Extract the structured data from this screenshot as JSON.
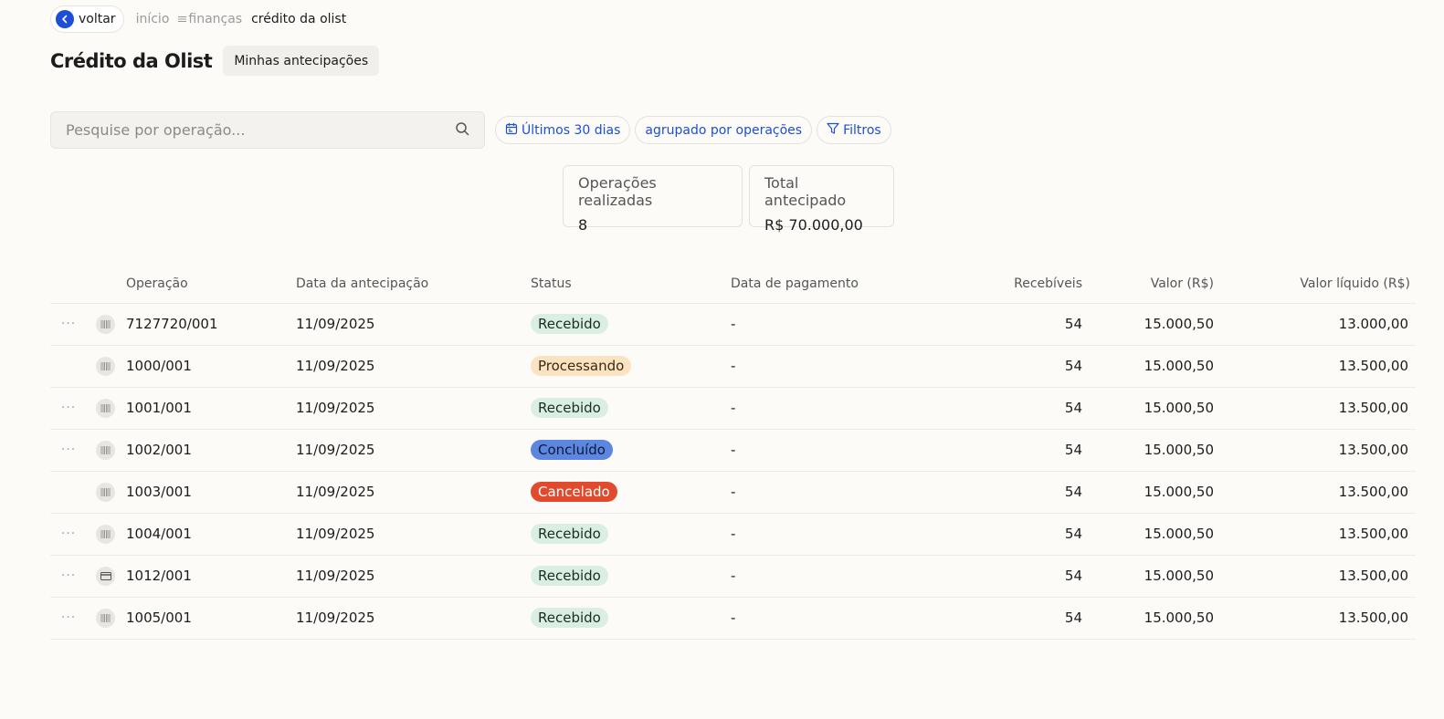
{
  "nav": {
    "back_label": "voltar",
    "crumb_home": "início",
    "crumb_finance": "finanças",
    "crumb_current": "crédito da olist"
  },
  "header": {
    "title": "Crédito da Olist",
    "tab_label": "Minhas antecipações"
  },
  "search": {
    "placeholder": "Pesquise por operação..."
  },
  "filters": {
    "period": "Últimos 30 dias",
    "grouping": "agrupado por operações",
    "more": "Filtros"
  },
  "stats": {
    "ops_label": "Operações realizadas",
    "ops_value": "8",
    "total_label": "Total antecipado",
    "total_value": "R$ 70.000,00"
  },
  "table": {
    "columns": [
      "Operação",
      "Data da antecipação",
      "Status",
      "Data de pagamento",
      "Recebíveis",
      "Valor (R$)",
      "Valor líquido (R$)"
    ],
    "rows": [
      {
        "menu": "···",
        "icon": "barcode-icon",
        "op": "7127720/001",
        "date": "11/09/2025",
        "status": "Recebido",
        "pay": "-",
        "rec": "54",
        "value": "15.000,50",
        "net": "13.000,00"
      },
      {
        "menu": "",
        "icon": "barcode-icon",
        "op": "1000/001",
        "date": "11/09/2025",
        "status": "Processando",
        "pay": "-",
        "rec": "54",
        "value": "15.000,50",
        "net": "13.500,00"
      },
      {
        "menu": "···",
        "icon": "barcode-icon",
        "op": "1001/001",
        "date": "11/09/2025",
        "status": "Recebido",
        "pay": "-",
        "rec": "54",
        "value": "15.000,50",
        "net": "13.500,00"
      },
      {
        "menu": "···",
        "icon": "barcode-icon",
        "op": "1002/001",
        "date": "11/09/2025",
        "status": "Concluído",
        "pay": "-",
        "rec": "54",
        "value": "15.000,50",
        "net": "13.500,00"
      },
      {
        "menu": "",
        "icon": "barcode-icon",
        "op": "1003/001",
        "date": "11/09/2025",
        "status": "Cancelado",
        "pay": "-",
        "rec": "54",
        "value": "15.000,50",
        "net": "13.500,00"
      },
      {
        "menu": "···",
        "icon": "barcode-icon",
        "op": "1004/001",
        "date": "11/09/2025",
        "status": "Recebido",
        "pay": "-",
        "rec": "54",
        "value": "15.000,50",
        "net": "13.500,00"
      },
      {
        "menu": "···",
        "icon": "card-icon",
        "op": "1012/001",
        "date": "11/09/2025",
        "status": "Recebido",
        "pay": "-",
        "rec": "54",
        "value": "15.000,50",
        "net": "13.500,00"
      },
      {
        "menu": "···",
        "icon": "barcode-icon",
        "op": "1005/001",
        "date": "11/09/2025",
        "status": "Recebido",
        "pay": "-",
        "rec": "54",
        "value": "15.000,50",
        "net": "13.500,00"
      }
    ]
  },
  "status_colors": {
    "Recebido": "#dbeee2",
    "Processando": "#fbe3c2",
    "Concluído": "#5d86e0",
    "Cancelado": "#e14a2d"
  },
  "accent_color": "#1d4ed8"
}
